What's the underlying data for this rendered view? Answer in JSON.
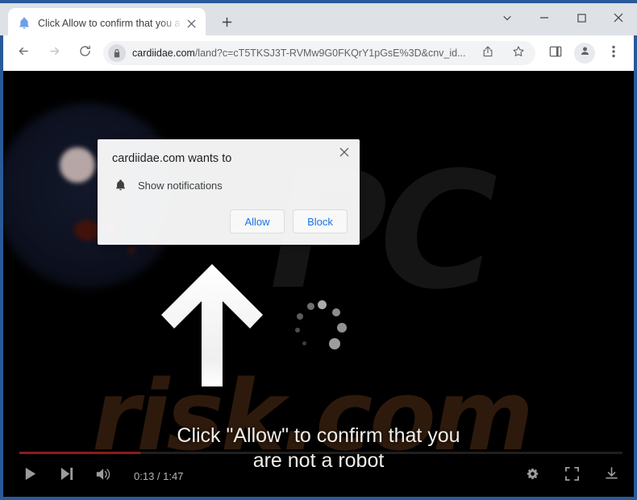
{
  "browser": {
    "tab": {
      "title": "Click Allow to confirm that you a",
      "favicon": "bell-icon",
      "close_icon": "close-icon"
    },
    "new_tab_icon": "plus-icon",
    "window_controls": [
      {
        "name": "tab-search-button",
        "icon": "chevron-down-icon"
      },
      {
        "name": "minimize-button",
        "icon": "minimize-icon"
      },
      {
        "name": "maximize-button",
        "icon": "maximize-icon"
      },
      {
        "name": "close-window-button",
        "icon": "close-icon"
      }
    ],
    "toolbar": {
      "back_icon": "arrow-left-icon",
      "forward_icon": "arrow-right-icon",
      "reload_icon": "reload-icon",
      "lock_icon": "lock-icon",
      "url_host": "cardiidae.com",
      "url_path": "/land?c=cT5TKSJ3T-RVMw9G0FKQrY1pGsE%3D&cnv_id...",
      "share_icon": "share-icon",
      "bookmark_icon": "star-icon",
      "side_panel_icon": "side-panel-icon",
      "profile_icon": "person-icon",
      "menu_icon": "three-dots-icon"
    }
  },
  "permission_dialog": {
    "title": "cardiidae.com wants to",
    "permission_icon": "bell-icon",
    "permission_label": "Show notifications",
    "allow_label": "Allow",
    "block_label": "Block",
    "close_icon": "close-icon"
  },
  "page": {
    "overlay_line1": "Click \"Allow\" to confirm that you",
    "overlay_line2": "are not a robot",
    "watermark_pc": "PC",
    "watermark_risk": "risk.com",
    "arrow_icon": "arrow-up-icon",
    "spinner_icon": "loading-spinner-icon"
  },
  "video_controls": {
    "play_icon": "play-icon",
    "next_icon": "next-track-icon",
    "volume_icon": "volume-on-icon",
    "time": "0:13 / 1:47",
    "progress_percent": 20,
    "settings_icon": "gear-icon",
    "fullscreen_icon": "fullscreen-icon",
    "download_icon": "download-icon"
  },
  "colors": {
    "frame": "#2a5999",
    "tabstrip": "#dee1e6",
    "accent_link": "#1a73e8",
    "progress": "#8c1c1c",
    "watermark": "#2e1a0c"
  }
}
